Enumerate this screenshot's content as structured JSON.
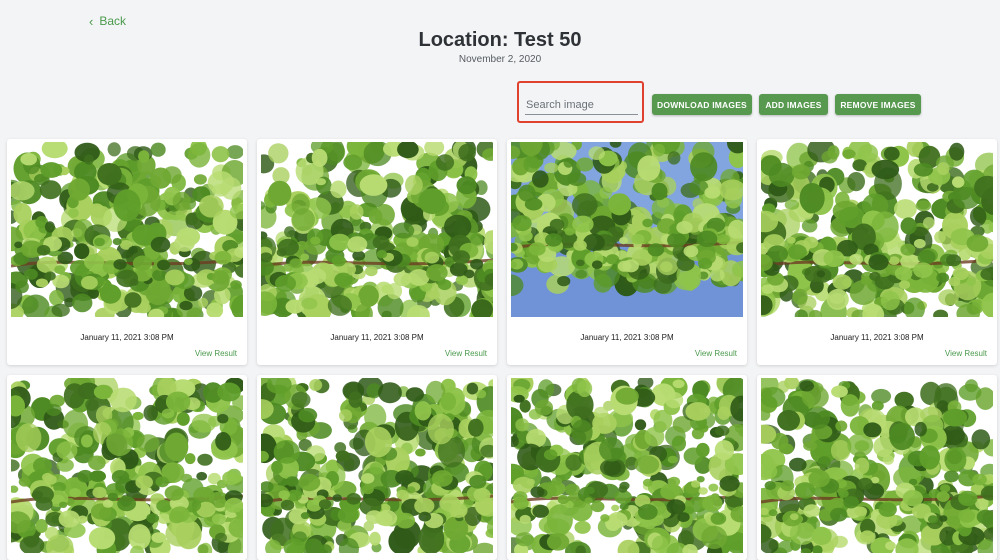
{
  "nav": {
    "back_label": "Back",
    "back_icon": "chevron-left-icon"
  },
  "header": {
    "title": "Location: Test 50",
    "date": "November 2, 2020"
  },
  "search": {
    "placeholder": "Search image",
    "value": ""
  },
  "toolbar": {
    "download_label": "DOWNLOAD IMAGES",
    "add_label": "ADD IMAGES",
    "remove_label": "REMOVE IMAGES"
  },
  "colors": {
    "accent": "#56994f",
    "link": "#4a9a4c",
    "highlight": "#e0412f",
    "background": "#f3f4f6"
  },
  "cards": [
    {
      "timestamp": "January 11, 2021 3:08 PM",
      "link_label": "View Result",
      "sky": "white"
    },
    {
      "timestamp": "January 11, 2021 3:08 PM",
      "link_label": "View Result",
      "sky": "white"
    },
    {
      "timestamp": "January 11, 2021 3:08 PM",
      "link_label": "View Result",
      "sky": "blue"
    },
    {
      "timestamp": "January 11, 2021 3:08 PM",
      "link_label": "View Result",
      "sky": "white"
    },
    {
      "sky": "white"
    },
    {
      "sky": "white"
    },
    {
      "sky": "white"
    },
    {
      "sky": "white"
    }
  ]
}
